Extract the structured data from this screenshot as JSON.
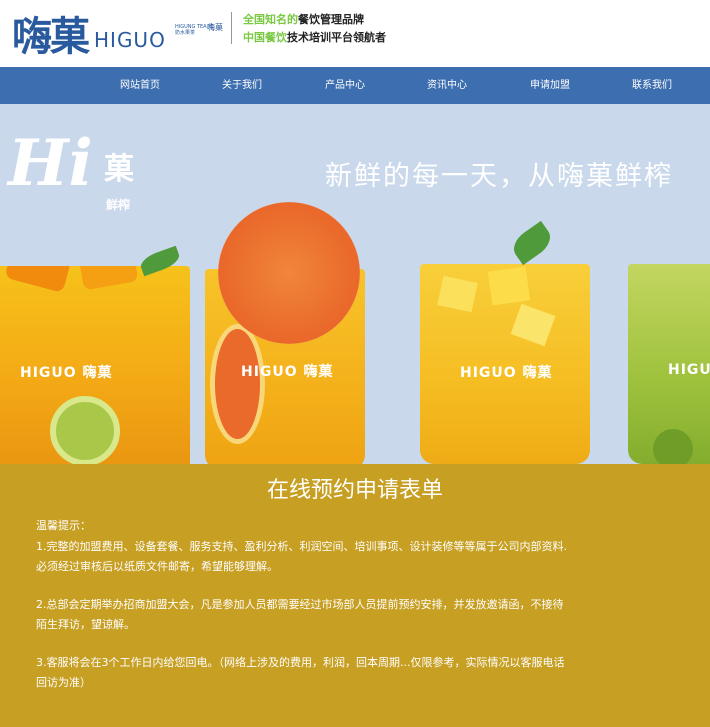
{
  "header": {
    "logo_cn": "嗨菓",
    "logo_en": "HIGUO",
    "logo_small": "HIGUNG TEA 鲜奶水果茶",
    "logo_mark": "嗨菓",
    "slogan_line1_highlight": "全国知名的",
    "slogan_line1_rest": "餐饮管理品牌",
    "slogan_line2_highlight": "中国餐饮",
    "slogan_line2_rest": "技术培训平台领航者"
  },
  "nav": {
    "items": [
      {
        "label": "网站首页"
      },
      {
        "label": "关于我们"
      },
      {
        "label": "产品中心"
      },
      {
        "label": "资讯中心"
      },
      {
        "label": "申请加盟"
      },
      {
        "label": "联系我们"
      }
    ]
  },
  "banner": {
    "title": "新鲜的每一天，从嗨菓鲜榨",
    "hi_text": "Hi",
    "hi_guo": "菓",
    "hi_sub": "鲜榨",
    "cup_brand": "HIGUO 嗨菓",
    "cup_brand_partial": "HIGU"
  },
  "form": {
    "title": "在线预约申请表单",
    "tips_label": "温馨提示：",
    "tip1_a": "1.完整的加盟费用、设备套餐、服务支持、盈利分析、利润空间、培训事项、设计装修等等属于公司内部资料.",
    "tip1_b": "必须经过审核后以纸质文件邮寄，希望能够理解。",
    "tip2_a": "2.总部会定期举办招商加盟大会，凡是参加人员都需要经过市场部人员提前预约安排，并发放邀请函，不接待",
    "tip2_b": "陌生拜访，望谅解。",
    "tip3_a": "3.客服将会在3个工作日内给您回电。（网络上涉及的费用，利润，回本周期...仅限参考，实际情况以客服电话",
    "tip3_b": "回访为准）"
  },
  "colors": {
    "brand_blue": "#2a5a9e",
    "nav_blue": "#3d6eb0",
    "banner_bg": "#c9d8eb",
    "form_gold": "#c79f23",
    "slogan_green": "#7ac943"
  }
}
